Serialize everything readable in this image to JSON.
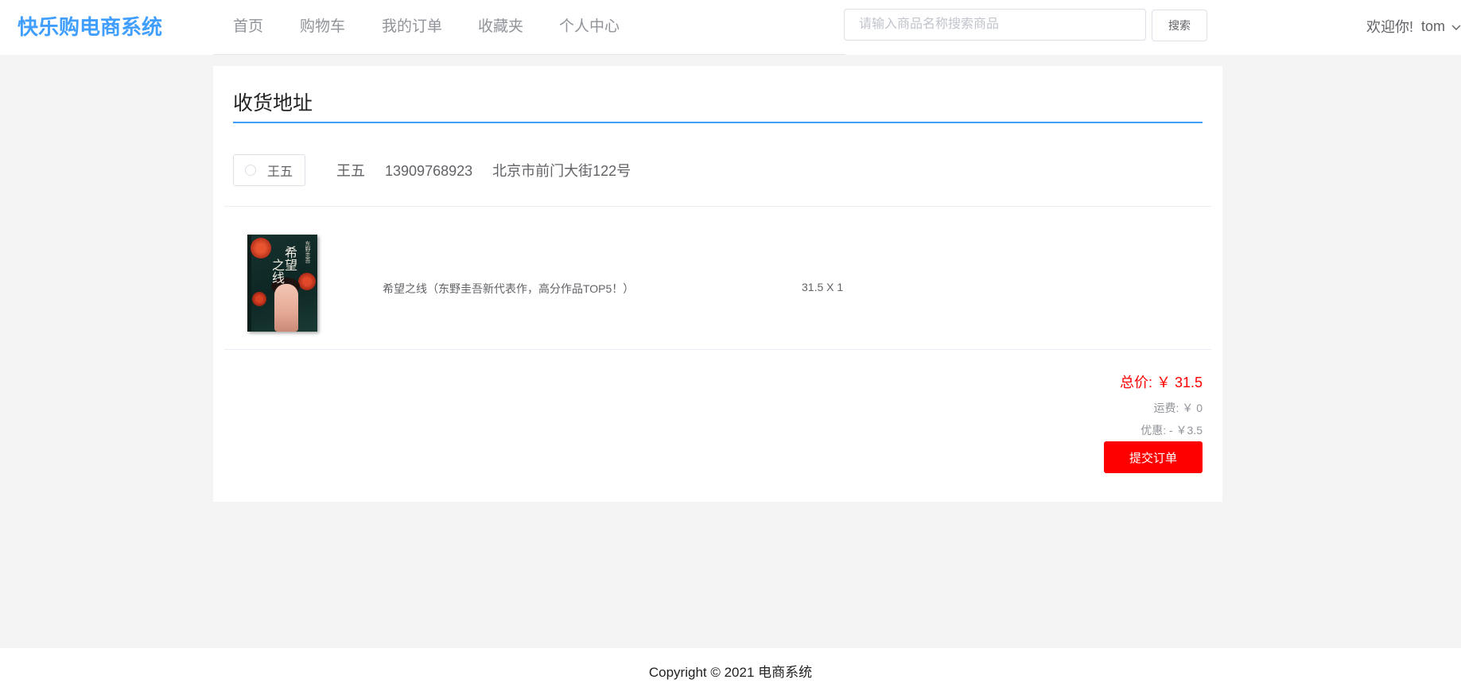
{
  "header": {
    "logo": "快乐购电商系统",
    "nav": [
      {
        "label": "首页"
      },
      {
        "label": "购物车"
      },
      {
        "label": "我的订单"
      },
      {
        "label": "收藏夹"
      },
      {
        "label": "个人中心"
      }
    ],
    "search": {
      "placeholder": "请输入商品名称搜索商品",
      "value": "",
      "button_label": "搜索"
    },
    "user": {
      "greeting": "欢迎你!",
      "name": "tom",
      "dropdown_icon": "chevron-down-icon"
    }
  },
  "address_section": {
    "title": "收货地址",
    "addresses": [
      {
        "radio_label": "王五",
        "selected": false,
        "name": "王五",
        "phone": "13909768923",
        "address": "北京市前门大街122号"
      }
    ]
  },
  "order_items": [
    {
      "name": "希望之线（东野圭吾新代表作，高分作品TOP5！）",
      "price_qty": "31.5 X 1",
      "cover": {
        "title_a": "希望",
        "title_b": "之线",
        "author": "东野圭吾"
      }
    }
  ],
  "summary": {
    "total": "总价: ￥ 31.5",
    "shipping": "运费:  ￥ 0",
    "discount": "优惠:  - ￥3.5",
    "submit_label": "提交订单"
  },
  "colors": {
    "brand": "#409eff",
    "danger": "#ff0000",
    "muted": "#909399"
  },
  "footer": {
    "copyright": "Copyright © 2021 电商系统"
  }
}
